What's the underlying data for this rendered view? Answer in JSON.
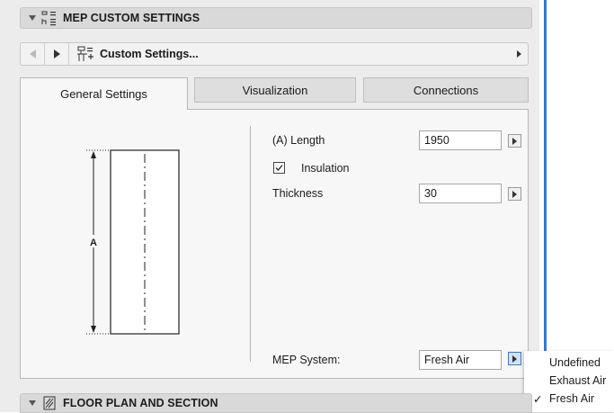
{
  "panel": {
    "section_title": "MEP CUSTOM SETTINGS",
    "nav_label": "Custom Settings...",
    "bottom_section_title": "FLOOR PLAN AND SECTION"
  },
  "tabs": [
    {
      "label": "General Settings",
      "active": true
    },
    {
      "label": "Visualization",
      "active": false
    },
    {
      "label": "Connections",
      "active": false
    }
  ],
  "preview": {
    "dimension_label": "A"
  },
  "fields": {
    "length": {
      "label": "(A) Length",
      "value": "1950"
    },
    "insulation": {
      "label": "Insulation",
      "checked": true
    },
    "thickness": {
      "label": "Thickness",
      "value": "30"
    },
    "mep_system": {
      "label": "MEP System:",
      "value": "Fresh Air"
    }
  },
  "dropdown": {
    "options": [
      {
        "label": "Undefined",
        "selected": false
      },
      {
        "label": "Exhaust Air",
        "selected": false
      },
      {
        "label": "Fresh Air",
        "selected": true
      }
    ],
    "check_mark": "✓"
  },
  "colors": {
    "accent": "#2f7bd6"
  }
}
